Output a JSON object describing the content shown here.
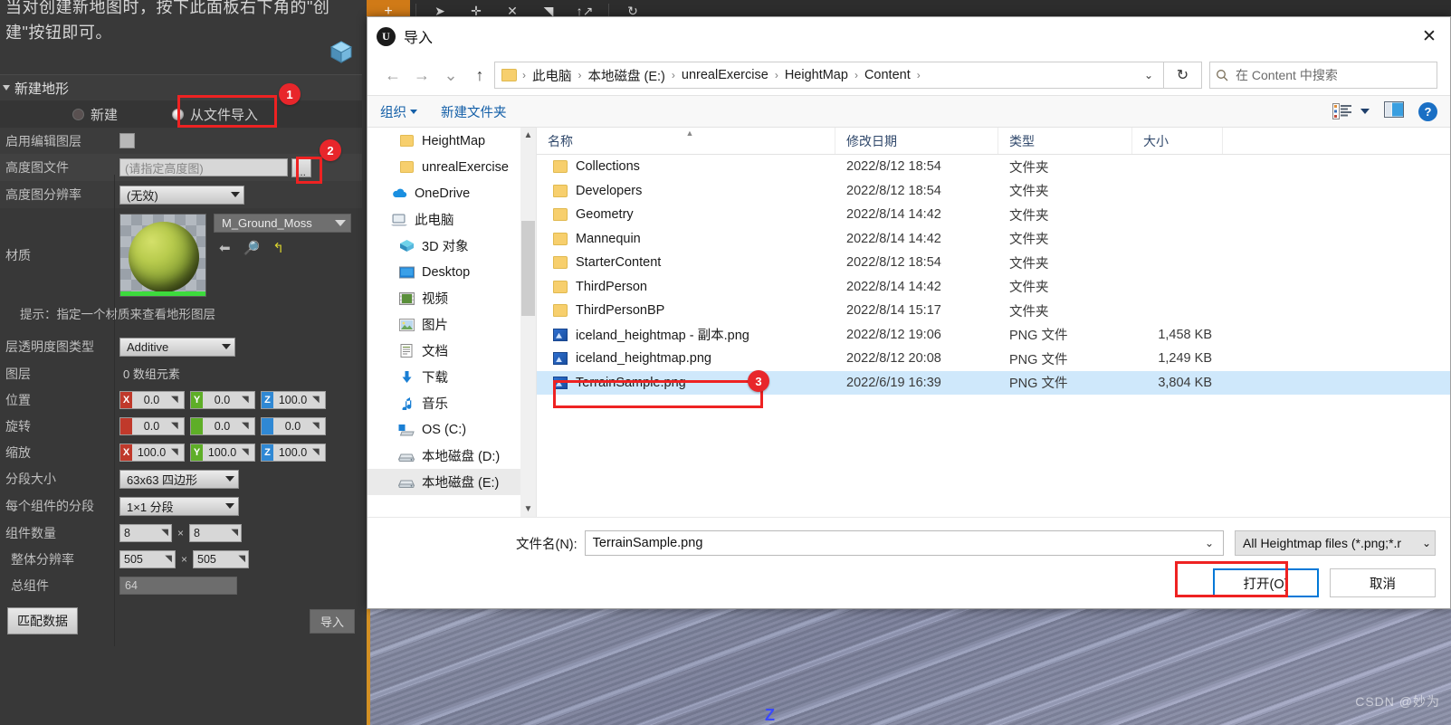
{
  "editor": {
    "note_text": "当对创建新地图时，按下此面板右下角的\"创建\"按钮即可。",
    "toolbar": {
      "plus_label": "+",
      "icons": [
        "cursor-icon",
        "plus-icon",
        "x-icon",
        "pen-icon",
        "move-icon",
        "rotate-icon"
      ]
    },
    "panel": {
      "title": "新建地形",
      "mode_new": "新建",
      "mode_import": "从文件导入",
      "rows": {
        "enable_edit_layers": "启用编辑图层",
        "heightmap_file": "高度图文件",
        "heightmap_file_placeholder": "(请指定高度图)",
        "browse_button": "...",
        "heightmap_resolution": "高度图分辨率",
        "heightmap_resolution_value": "(无效)",
        "material": "材质",
        "material_value": "M_Ground_Moss",
        "hint": "提示：指定一个材质来查看地形图层",
        "layer_alpha_type": "层透明度图类型",
        "layer_alpha_type_value": "Additive",
        "layers": "图层",
        "layers_value": "0 数组元素",
        "location": "位置",
        "rotation": "旋转",
        "scale": "缩放",
        "section_size": "分段大小",
        "section_size_value": "63x63 四边形",
        "sections_per_component": "每个组件的分段",
        "sections_per_component_value": "1×1 分段",
        "component_count": "组件数量",
        "overall_resolution": "整体分辨率",
        "total_components": "总组件",
        "total_components_value": "64"
      },
      "location_values": {
        "x": "0.0",
        "y": "0.0",
        "z": "100.0"
      },
      "rotation_values": {
        "x": "0.0",
        "y": "0.0",
        "z": "0.0"
      },
      "scale_values": {
        "x": "100.0",
        "y": "100.0",
        "z": "100.0"
      },
      "component_count_values": {
        "w": "8",
        "h": "8"
      },
      "overall_resolution_values": {
        "w": "505",
        "h": "505"
      },
      "buttons": {
        "match_data": "匹配数据",
        "import": "导入"
      },
      "material_tools": {
        "back": "back-arrow-icon",
        "browse": "search-icon",
        "reset": "reset-icon"
      }
    },
    "viewport": {
      "axis_label": "Z",
      "watermark": "CSDN @妙为"
    }
  },
  "dialog": {
    "title": "导入",
    "close_label": "✕",
    "nav": {
      "back": "←",
      "forward": "→",
      "recent": "⌄",
      "up": "↑",
      "crumbs": [
        "此电脑",
        "本地磁盘 (E:)",
        "unrealExercise",
        "HeightMap",
        "Content"
      ],
      "refresh": "↻",
      "search_placeholder": "在 Content 中搜索"
    },
    "commands": {
      "organize": "组织",
      "new_folder": "新建文件夹",
      "help": "?"
    },
    "tree": [
      {
        "label": "HeightMap",
        "icon": "folder-icon",
        "level": 2,
        "selected": false
      },
      {
        "label": "unrealExercise",
        "icon": "folder-icon",
        "level": 2,
        "selected": false
      },
      {
        "label": "OneDrive",
        "icon": "cloud-icon",
        "level": 1,
        "selected": false
      },
      {
        "label": "此电脑",
        "icon": "computer-icon",
        "level": 1,
        "selected": false
      },
      {
        "label": "3D 对象",
        "icon": "cube-icon",
        "level": 2,
        "selected": false
      },
      {
        "label": "Desktop",
        "icon": "desktop-icon",
        "level": 2,
        "selected": false
      },
      {
        "label": "视频",
        "icon": "video-icon",
        "level": 2,
        "selected": false
      },
      {
        "label": "图片",
        "icon": "picture-icon",
        "level": 2,
        "selected": false
      },
      {
        "label": "文档",
        "icon": "document-icon",
        "level": 2,
        "selected": false
      },
      {
        "label": "下载",
        "icon": "download-icon",
        "level": 2,
        "selected": false
      },
      {
        "label": "音乐",
        "icon": "music-icon",
        "level": 2,
        "selected": false
      },
      {
        "label": "OS (C:)",
        "icon": "windows-drive-icon",
        "level": 2,
        "selected": false
      },
      {
        "label": "本地磁盘 (D:)",
        "icon": "drive-icon",
        "level": 2,
        "selected": false
      },
      {
        "label": "本地磁盘 (E:)",
        "icon": "drive-icon",
        "level": 2,
        "selected": true
      }
    ],
    "columns": [
      "名称",
      "修改日期",
      "类型",
      "大小"
    ],
    "files": [
      {
        "name": "Collections",
        "date": "2022/8/12 18:54",
        "type": "文件夹",
        "size": "",
        "icon": "folder-icon",
        "selected": false
      },
      {
        "name": "Developers",
        "date": "2022/8/12 18:54",
        "type": "文件夹",
        "size": "",
        "icon": "folder-icon",
        "selected": false
      },
      {
        "name": "Geometry",
        "date": "2022/8/14 14:42",
        "type": "文件夹",
        "size": "",
        "icon": "folder-icon",
        "selected": false
      },
      {
        "name": "Mannequin",
        "date": "2022/8/14 14:42",
        "type": "文件夹",
        "size": "",
        "icon": "folder-icon",
        "selected": false
      },
      {
        "name": "StarterContent",
        "date": "2022/8/12 18:54",
        "type": "文件夹",
        "size": "",
        "icon": "folder-icon",
        "selected": false
      },
      {
        "name": "ThirdPerson",
        "date": "2022/8/14 14:42",
        "type": "文件夹",
        "size": "",
        "icon": "folder-icon",
        "selected": false
      },
      {
        "name": "ThirdPersonBP",
        "date": "2022/8/14 15:17",
        "type": "文件夹",
        "size": "",
        "icon": "folder-icon",
        "selected": false
      },
      {
        "name": "iceland_heightmap - 副本.png",
        "date": "2022/8/12 19:06",
        "type": "PNG 文件",
        "size": "1,458 KB",
        "icon": "png-icon",
        "selected": false
      },
      {
        "name": "iceland_heightmap.png",
        "date": "2022/8/12 20:08",
        "type": "PNG 文件",
        "size": "1,249 KB",
        "icon": "png-icon",
        "selected": false
      },
      {
        "name": "TerrainSample.png",
        "date": "2022/6/19 16:39",
        "type": "PNG 文件",
        "size": "3,804 KB",
        "icon": "png-icon",
        "selected": true
      }
    ],
    "footer": {
      "filename_label": "文件名(N):",
      "filename_value": "TerrainSample.png",
      "filter_value": "All Heightmap files (*.png;*.r",
      "open_button": "打开(O)",
      "cancel_button": "取消"
    }
  },
  "annotations": {
    "badge1": "1",
    "badge2": "2",
    "badge3": "3",
    "color": "#ee2222"
  }
}
